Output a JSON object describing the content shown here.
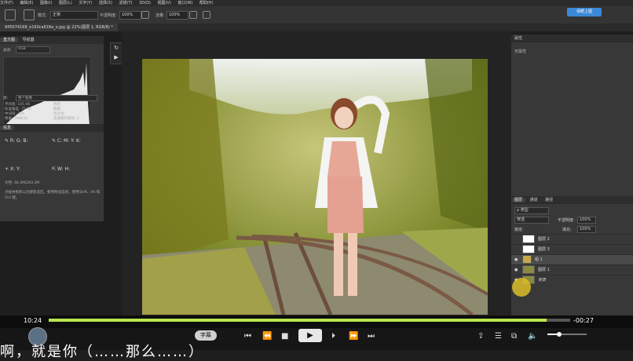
{
  "menubar": [
    "文件(F)",
    "编辑(E)",
    "图像(I)",
    "图层(L)",
    "文字(Y)",
    "选择(S)",
    "滤镜(T)",
    "3D(D)",
    "视图(V)",
    "窗口(W)",
    "帮助(H)"
  ],
  "options": {
    "mode_label": "模式:",
    "mode_value": "正常",
    "opacity_label": "不透明度:",
    "opacity_value": "100%",
    "flow_label": "流量:",
    "flow_value": "100%"
  },
  "login_button": "佰晤上图",
  "doc_tab": "945074168_e160ca618a_o.jpg @ 22%(图层 1, RGB/8) *",
  "left_panel": {
    "tabs": [
      "直方图",
      "导航器"
    ],
    "channel_label": "通道:",
    "channel_value": "RGB",
    "source_label": "源:",
    "source_value": "整个图像",
    "stats_left": [
      "平均值: 145.06",
      "标准偏差: 75.06",
      "中间值: 144",
      "像素: 298632"
    ],
    "stats_right": [
      "色阶:",
      "数量:",
      "百分位:",
      "高速缓存级别: 4"
    ],
    "info_tab": "信息",
    "info_doc": "文档: 46.4M/283.3M",
    "info_hint": "点按并拖移以创建新选区。要用附加选项，使用Shift、Alt 和 Ctrl 键。"
  },
  "right_panel": {
    "properties_title": "属性",
    "properties_empty": "无属性",
    "layers_tabs": [
      "图层",
      "通道",
      "路径"
    ],
    "kind_label": "ρ 类型",
    "blend_value": "穿透",
    "opacity_label": "不透明度:",
    "opacity_value": "100%",
    "lock_label": "锁定:",
    "fill_label": "填充:",
    "fill_value": "100%",
    "layers": [
      {
        "name": "图层 2",
        "visible": false
      },
      {
        "name": "图层 3",
        "visible": false
      },
      {
        "name": "组 1",
        "visible": true
      },
      {
        "name": "图层 1",
        "visible": true
      },
      {
        "name": "背景",
        "visible": true
      }
    ]
  },
  "player": {
    "elapsed": "10:24",
    "remaining": "-00:27",
    "progress": 0.955,
    "volume": 0.3,
    "subtitle_button": "字幕",
    "icons": [
      "prev-icon",
      "rewind-icon",
      "stop-icon",
      "play-icon",
      "next-frame-icon",
      "fast-forward-icon",
      "skip-next-icon",
      "share-icon",
      "playlist-icon",
      "screenshot-icon",
      "volume-icon"
    ]
  },
  "caption_overlay": "啊，就是你（……那么……）"
}
